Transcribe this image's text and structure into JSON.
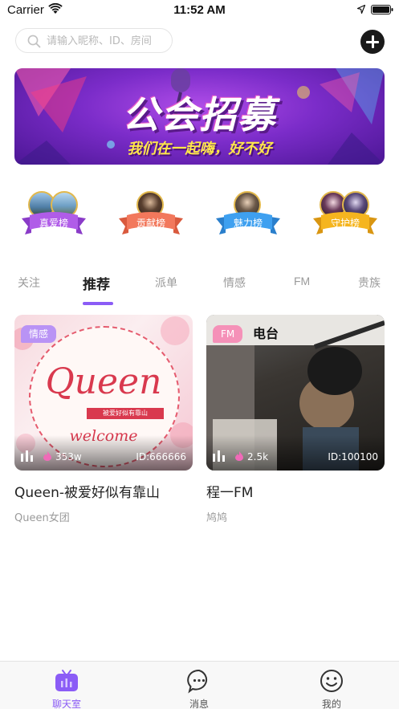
{
  "status_bar": {
    "carrier": "Carrier",
    "time": "11:52 AM"
  },
  "search": {
    "placeholder": "请输入昵称、ID、房间"
  },
  "banner": {
    "title": "公会招募",
    "subtitle": "我们在一起嗨，好不好"
  },
  "rankings": [
    {
      "label": "真爱榜",
      "color": "#b05ce8"
    },
    {
      "label": "贡献榜",
      "color": "#f2785c"
    },
    {
      "label": "魅力榜",
      "color": "#3ea0f0"
    },
    {
      "label": "守护榜",
      "color": "#f5b51f"
    }
  ],
  "tabs": [
    {
      "label": "关注"
    },
    {
      "label": "推荐",
      "active": true
    },
    {
      "label": "派单"
    },
    {
      "label": "情感"
    },
    {
      "label": "FM"
    },
    {
      "label": "贵族"
    }
  ],
  "rooms": [
    {
      "tag": "情感",
      "cover_word": "Queen",
      "cover_slogan": "被爱好似有靠山",
      "cover_welcome": "welcome",
      "heat": "353w",
      "room_id": "ID:666666",
      "title": "Queen-被爱好似有靠山",
      "subtitle": "Queen女团"
    },
    {
      "tag": "FM",
      "cover_word": "电台",
      "heat": "2.5k",
      "room_id": "ID:100100",
      "title": "程一FM",
      "subtitle": "鸠鸠"
    }
  ],
  "bottom_nav": [
    {
      "label": "聊天室",
      "icon": "tv-icon",
      "active": true
    },
    {
      "label": "消息",
      "icon": "message-bubble-icon"
    },
    {
      "label": "我的",
      "icon": "smiley-face-icon"
    }
  ],
  "colors": {
    "accent": "#8b5cf6",
    "tab_inactive": "#9a9a9a"
  }
}
